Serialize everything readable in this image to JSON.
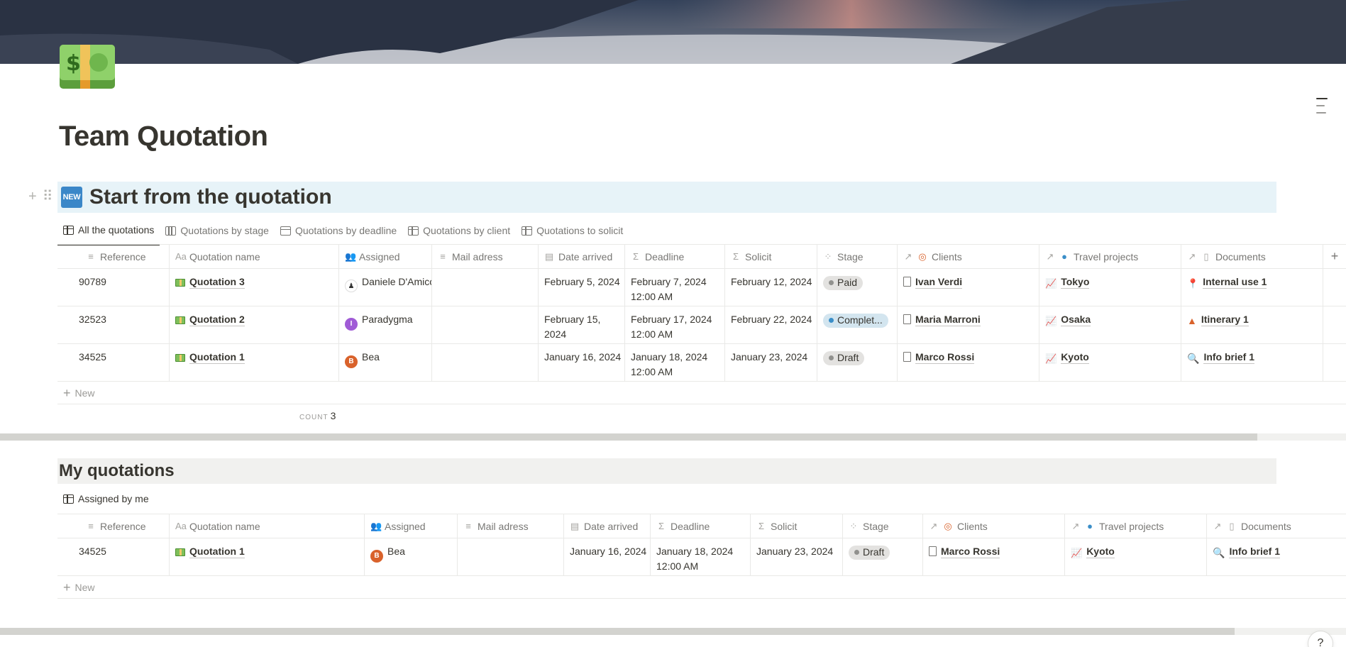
{
  "page": {
    "title": "Team Quotation",
    "icon": "money-banknote-icon"
  },
  "section1": {
    "badge": "NEW",
    "heading": "Start from the quotation",
    "tabs": [
      {
        "label": "All the quotations",
        "icon": "table-icon",
        "active": true
      },
      {
        "label": "Quotations by stage",
        "icon": "board-icon",
        "active": false
      },
      {
        "label": "Quotations by deadline",
        "icon": "calendar-icon",
        "active": false
      },
      {
        "label": "Quotations by client",
        "icon": "table-icon",
        "active": false
      },
      {
        "label": "Quotations to solicit",
        "icon": "table-icon",
        "active": false
      }
    ],
    "columns": [
      "Reference",
      "Quotation name",
      "Assigned",
      "Mail adress",
      "Date arrived",
      "Deadline",
      "Solicit",
      "Stage",
      "Clients",
      "Travel projects",
      "Documents"
    ],
    "rows": [
      {
        "reference": "90789",
        "name": "Quotation 3",
        "assigned": "Daniele D'Amico",
        "mail": "",
        "date_arrived": "February 5, 2024",
        "deadline": "February 7, 2024 12:00 AM",
        "solicit": "February 12, 2024",
        "stage": "Paid",
        "client": "Ivan Verdi",
        "project": "Tokyo",
        "document": "Internal use 1"
      },
      {
        "reference": "32523",
        "name": "Quotation 2",
        "assigned": "Paradygma",
        "mail": "",
        "date_arrived": "February 15, 2024",
        "deadline": "February 17, 2024 12:00 AM",
        "solicit": "February 22, 2024",
        "stage": "Complet...",
        "client": "Maria Marroni",
        "project": "Osaka",
        "document": "Itinerary 1"
      },
      {
        "reference": "34525",
        "name": "Quotation 1",
        "assigned": "Bea",
        "mail": "",
        "date_arrived": "January 16, 2024",
        "deadline": "January 18, 2024 12:00 AM",
        "solicit": "January 23, 2024",
        "stage": "Draft",
        "client": "Marco Rossi",
        "project": "Kyoto",
        "document": "Info brief 1"
      }
    ],
    "new_label": "New",
    "count_label": "COUNT",
    "count_value": "3"
  },
  "section2": {
    "heading": "My quotations",
    "tabs": [
      {
        "label": "Assigned by me",
        "icon": "table-icon",
        "active": true
      }
    ],
    "rows": [
      {
        "reference": "34525",
        "name": "Quotation 1",
        "assigned": "Bea",
        "mail": "",
        "date_arrived": "January 16, 2024",
        "deadline": "January 18, 2024 12:00 AM",
        "solicit": "January 23, 2024",
        "stage": "Draft",
        "client": "Marco Rossi",
        "project": "Kyoto",
        "document": "Info brief 1"
      }
    ],
    "new_label": "New"
  },
  "avatars": {
    "Daniele": "D",
    "Paradygma": "I",
    "Bea": "B"
  },
  "help_label": "?",
  "colors": {
    "section1_bg": "#e7f3f8",
    "section2_bg": "#f1f1ef",
    "badge": "#3b87c8",
    "stage_gray": "#e3e2e0",
    "stage_blue": "#d3e5ef"
  }
}
